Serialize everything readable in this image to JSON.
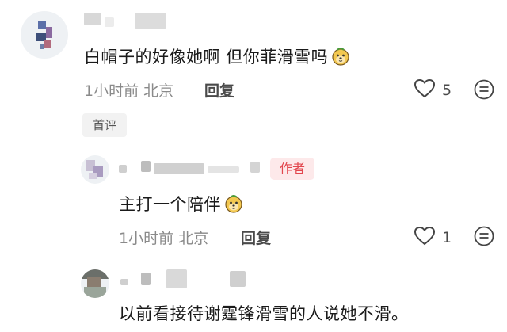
{
  "comments": [
    {
      "text": "白帽子的好像她啊 但你菲滑雪吗",
      "time": "1小时前",
      "location": "北京",
      "reply_label": "回复",
      "like_count": "5",
      "tag": "首评"
    },
    {
      "author_tag": "作者",
      "text": "主打一个陪伴",
      "time": "1小时前",
      "location": "北京",
      "reply_label": "回复",
      "like_count": "1"
    },
    {
      "text": "以前看接待谢霆锋滑雪的人说她不滑。"
    }
  ],
  "icons": {
    "emoji": "dog-face-emoji-icon",
    "like": "heart-outline-icon",
    "more": "more-dots-icon"
  },
  "colors": {
    "author_tag_bg": "#fde9ea",
    "author_tag_text": "#e2474e",
    "meta_gray": "#8a8a8a"
  }
}
